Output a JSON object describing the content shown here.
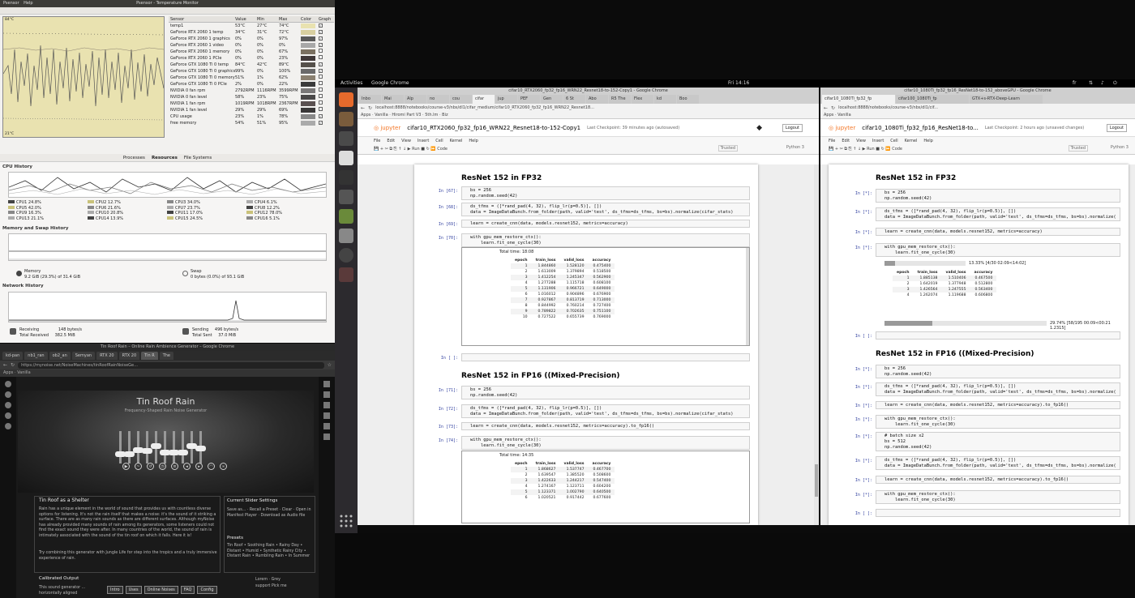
{
  "temp_monitor": {
    "title": "Psensor - Temperature Monitor",
    "menu": [
      "Psensor",
      "Help"
    ],
    "graph_top_label": "84°C",
    "graph_bottom_label": "21°C",
    "columns": [
      "Sensor",
      "Value",
      "Min",
      "Max",
      "Color",
      "Graph"
    ],
    "rows": [
      {
        "sensor": "temp1",
        "value": "53°C",
        "min": "27°C",
        "max": "74°C",
        "color": "#e9e2b0",
        "graph": "✓"
      },
      {
        "sensor": "GeForce RTX 2060 1 temp",
        "value": "34°C",
        "min": "31°C",
        "max": "72°C",
        "color": "#d8cfa0",
        "graph": "✓"
      },
      {
        "sensor": "GeForce RTX 2060 1 graphics",
        "value": "0%",
        "min": "0%",
        "max": "97%",
        "color": "#5a5a5a",
        "graph": "✓"
      },
      {
        "sensor": "GeForce RTX 2060 1 video",
        "value": "0%",
        "min": "0%",
        "max": "0%",
        "color": "#a8a8a8",
        "graph": "✓"
      },
      {
        "sensor": "GeForce RTX 2060 1 memory",
        "value": "0%",
        "min": "0%",
        "max": "67%",
        "color": "#7a7060",
        "graph": ""
      },
      {
        "sensor": "GeForce RTX 2060 1 PCIe",
        "value": "0%",
        "min": "0%",
        "max": "23%",
        "color": "#403838",
        "graph": ""
      },
      {
        "sensor": "GeForce GTX 1080 Ti 0 temp",
        "value": "84°C",
        "min": "42°C",
        "max": "89°C",
        "color": "#55504a",
        "graph": "✓"
      },
      {
        "sensor": "GeForce GTX 1080 Ti 0 graphics",
        "value": "99%",
        "min": "0%",
        "max": "100%",
        "color": "#6a6a6a",
        "graph": "✓"
      },
      {
        "sensor": "GeForce GTX 1080 Ti 0 memory",
        "value": "51%",
        "min": "1%",
        "max": "62%",
        "color": "#8a8070",
        "graph": ""
      },
      {
        "sensor": "GeForce GTX 1080 Ti 0 PCIe",
        "value": "2%",
        "min": "0%",
        "max": "22%",
        "color": "#3a3a3a",
        "graph": ""
      },
      {
        "sensor": "NVIDIA 0 fan rpm",
        "value": "2792RPM",
        "min": "1116RPM",
        "max": "3599RPM",
        "color": "#7a7878",
        "graph": ""
      },
      {
        "sensor": "NVIDIA 0 fan level",
        "value": "58%",
        "min": "23%",
        "max": "75%",
        "color": "#4a4848",
        "graph": ""
      },
      {
        "sensor": "NVIDIA 1 fan rpm",
        "value": "1019RPM",
        "min": "1018RPM",
        "max": "2367RPM",
        "color": "#5a5050",
        "graph": ""
      },
      {
        "sensor": "NVIDIA 1 fan level",
        "value": "29%",
        "min": "29%",
        "max": "69%",
        "color": "#3a3838",
        "graph": ""
      },
      {
        "sensor": "CPU usage",
        "value": "23%",
        "min": "1%",
        "max": "78%",
        "color": "#888",
        "graph": "✓"
      },
      {
        "sensor": "free memory",
        "value": "54%",
        "min": "51%",
        "max": "95%",
        "color": "#aaa",
        "graph": "✓"
      }
    ]
  },
  "sys_monitor": {
    "tabs": [
      "Processes",
      "Resources",
      "File Systems"
    ],
    "cpu_history": "CPU History",
    "cpu_legend": [
      [
        "CPU1 24.8%",
        "CPU5 42.0%",
        "CPU9 16.3%",
        "CPU13 21.1%"
      ],
      [
        "CPU2 12.7%",
        "CPU6 21.6%",
        "CPU10 20.8%",
        "CPU14 13.9%"
      ],
      [
        "CPU3 34.0%",
        "CPU7 23.7%",
        "CPU11 17.0%",
        "CPU15 24.5%"
      ],
      [
        "CPU4 6.1%",
        "CPU8 12.2%",
        "CPU12 78.0%",
        "CPU16 5.1%"
      ]
    ],
    "mem_title": "Memory and Swap History",
    "memory_label": "Memory",
    "memory_value": "9.2 GiB (29.3%) of 31.4 GiB",
    "swap_label": "Swap",
    "swap_value": "0 bytes (0.0%) of 93.1 GiB",
    "net_title": "Network History",
    "receiving_label": "Receiving",
    "receiving_value": "148 bytes/s",
    "total_received_label": "Total Received",
    "total_received_value": "382.5 MiB",
    "sending_label": "Sending",
    "sending_value": "496 bytes/s",
    "total_sent_label": "Total Sent",
    "total_sent_value": "37.0 MiB"
  },
  "mynoise": {
    "title": "Tin Roof Rain – Online Rain Ambience Generator – Google Chrome",
    "tabs": [
      "kd-pan",
      "nb1_ran",
      "ob2_an",
      "Semyan",
      "RTX 20",
      "RTX 20",
      "Tin R",
      "The"
    ],
    "url": "https://mynoise.net/NoiseMachines/tinRoofRainNoiseGe...",
    "bookmarks": "Apps  ·  Vanilla",
    "hero_title": "Tin Roof Rain",
    "hero_subtitle": "Frequency-Shaped Rain Noise Generator",
    "slider_levels": [
      0.25,
      0.25,
      0.4,
      0.35,
      0.55,
      0.3,
      0.3,
      0.3,
      0.55,
      0.45
    ],
    "section_title": "Tin Roof as a Shelter",
    "section_text": "Rain has a unique element in the world of sound that provides us with countless diverse options for listening. It's not the rain itself that makes a noise: it's the sound of it striking a surface. There are as many rain sounds as there are different surfaces. Although myNoise has already provided many sounds of rain among its generators, some listeners could not find the exact sound they were after. In many countries of the world, the sound of rain is intimately associated with the sound of the tin roof on which it falls. Here it is!",
    "section_text2": "Try combining this generator with Jungle Life for step into the tropics and a truly immersive experience of rain.",
    "settings_title": "Current Slider Settings",
    "settings_items": "Save as... · Recall a Preset · Clear · Open in Manifest Player · Download as Audio file",
    "presets_title": "Presets",
    "presets_text": "Tin Roof • Soothing Rain • Rainy Day • Distant • Humid • Synthetic Rainy City • Distant Rain • Rumbling Rain • In Summer",
    "calib_title": "Calibrated Output",
    "calib_text": "This sound generator ... horizontally aligned",
    "bottom_buttons": [
      "Intro",
      "Uses",
      "Online Noises",
      "FAQ",
      "Config"
    ],
    "lines_text": "Lorem · Grey",
    "support_text": "support Pick me"
  },
  "ubuntu": {
    "activities": "Activities",
    "app": "Google Chrome",
    "clock": "Fri 14:16",
    "lang": "fr"
  },
  "jupyter_left": {
    "window_title": "cifar10_RTX2060_fp32_fp16_WRN22_Resnet18-to-152-Copy1 - Google Chrome",
    "tabs": [
      "Inbo",
      "Mai",
      "Alp",
      "no",
      "cou",
      "cifar",
      "jup",
      "PEF",
      "Gen",
      "6 St",
      "Abo",
      "R5 The",
      "Flex",
      "kd",
      "Boo"
    ],
    "url": "localhost:8888/notebooks/course-v3/nbs/dl1/cifar_medium/cifar10_RTX2060_fp32_fp16_WRN22_Resnet18...",
    "bookmarks": "Apps · Vanilla · Hiromi Part V3 · 5th.lm · Biz",
    "nb_title": "cifar10_RTX2060_fp32_fp16_WRN22_Resnet18-to-152-Copy1",
    "checkpoint": "Last Checkpoint: 39 minutes ago  (autosaved)",
    "menu": [
      "File",
      "Edit",
      "View",
      "Insert",
      "Cell",
      "Kernel",
      "Help"
    ],
    "trusted": "Trusted",
    "kernel": "Python 3",
    "logout": "Logout",
    "h_fp32": "ResNet 152 in FP32",
    "p67": "In [67]:",
    "c67": "bs = 256\nnp.random.seed(42)",
    "p68": "In [68]:",
    "c68": "ds_tfms = ([*rand_pad(4, 32), flip_lr(p=0.5)], [])\ndata = ImageDataBunch.from_folder(path, valid='test', ds_tfms=ds_tfms, bs=bs).normalize(cifar_stats)",
    "p69": "In [69]:",
    "c69": "learn = create_cnn(data, models.resnet152, metrics=accuracy)",
    "p70": "In [70]:",
    "c70": "with gpu_mem_restore_ctx():\n    learn.fit_one_cycle(30)",
    "total_time_1": "Total time: 18:08",
    "table_cols": [
      "epoch",
      "train_loss",
      "valid_loss",
      "accuracy"
    ],
    "table1": [
      [
        "1",
        "1.844860",
        "1.528120",
        "0.475400"
      ],
      [
        "2",
        "1.613009",
        "1.379894",
        "0.518500"
      ],
      [
        "3",
        "1.412254",
        "1.245347",
        "0.562900"
      ],
      [
        "4",
        "1.277288",
        "1.115718",
        "0.608100"
      ],
      [
        "5",
        "1.131906",
        "0.966721",
        "0.649000"
      ],
      [
        "6",
        "1.016012",
        "0.904896",
        "0.676900"
      ],
      [
        "7",
        "0.927867",
        "0.813719",
        "0.713000"
      ],
      [
        "8",
        "0.844992",
        "0.760214",
        "0.727400"
      ],
      [
        "9",
        "0.789822",
        "0.702635",
        "0.751100"
      ],
      [
        "10",
        "0.727522",
        "0.655739",
        "0.769000"
      ]
    ],
    "p_empty": "In [ ]:",
    "h_fp16": "ResNet 152 in FP16 ((Mixed-Precision)",
    "p71": "In [71]:",
    "c71": "bs = 256\nnp.random.seed(42)",
    "p72": "In [72]:",
    "c72": "ds_tfms = ([*rand_pad(4, 32), flip_lr(p=0.5)], [])\ndata = ImageDataBunch.from_folder(path, valid='test', ds_tfms=ds_tfms, bs=bs).normalize(cifar_stats)",
    "p73": "In [73]:",
    "c73": "learn = create_cnn(data, models.resnet152, metrics=accuracy).to_fp16()",
    "p74": "In [74]:",
    "c74": "with gpu_mem_restore_ctx():\n    learn.fit_one_cycle(30)",
    "total_time_2": "Total time: 14:35",
    "table2": [
      [
        "1",
        "1.868627",
        "1.537747",
        "0.467700"
      ],
      [
        "2",
        "1.639547",
        "1.385520",
        "0.508600"
      ],
      [
        "3",
        "1.422633",
        "1.244217",
        "0.547400"
      ],
      [
        "4",
        "1.274167",
        "1.123711",
        "0.604200"
      ],
      [
        "5",
        "1.123371",
        "1.002790",
        "0.640500"
      ],
      [
        "6",
        "1.020521",
        "0.917442",
        "0.677600"
      ]
    ]
  },
  "jupyter_right": {
    "window_title": "cifar10_1080Ti_fp32_fp16_ResNet18-to-152_aboveGPU - Google Chrome",
    "tabs": [
      "cifar10_1080Ti_fp32_fp",
      "cifar100_1080Ti_fp",
      "GTX+s-RTX-Deep-Learn"
    ],
    "url": "localhost:8888/notebooks/course-v3/nbs/dl1/cif...",
    "bookmarks": "Apps · Vanilla",
    "nb_title": "cifar10_1080Ti_fp32_fp16_ResNet18-to...",
    "checkpoint": "Last Checkpoint: 2 hours ago  (unsaved changes)",
    "menu": [
      "File",
      "Edit",
      "View",
      "Insert",
      "Cell",
      "Kernel",
      "Help"
    ],
    "trusted": "Trusted",
    "kernel": "Python 3",
    "logout": "Logout",
    "h_fp32": "ResNet 152 in FP32",
    "p_star": "In [*]:",
    "c1": "bs = 256\nnp.random.seed(42)",
    "c2": "ds_tfms = ([*rand_pad(4, 32), flip_lr(p=0.5)], [])\ndata = ImageDataBunch.from_folder(path, valid='test', ds_tfms=ds_tfms, bs=bs).normalize(",
    "c3": "learn = create_cnn(data, models.resnet152, metrics=accuracy)",
    "c4": "with gpu_mem_restore_ctx():\n    learn.fit_one_cycle(30)",
    "progress1": "13.33% [4/30 02:09<14:02]",
    "progress1_value": 0.1333,
    "table_cols": [
      "epoch",
      "train_loss",
      "valid_loss",
      "accuracy"
    ],
    "table": [
      [
        "1",
        "1.885138",
        "1.510406",
        "0.467500"
      ],
      [
        "2",
        "1.642019",
        "1.377948",
        "0.512800"
      ],
      [
        "3",
        "1.426564",
        "1.247555",
        "0.563400"
      ],
      [
        "4",
        "1.262074",
        "1.119688",
        "0.606800"
      ]
    ],
    "progress2": "29.74% [58/195 00:09<00:21 1.2315]",
    "progress2_value": 0.2974,
    "p_empty": "In [ ]:",
    "h_fp16": "ResNet 152 in FP16 ((Mixed-Precision)",
    "c5": "bs = 256\nnp.random.seed(42)",
    "c6": "ds_tfms = ([*rand_pad(4, 32), flip_lr(p=0.5)], [])\ndata = ImageDataBunch.from_folder(path, valid='test', ds_tfms=ds_tfms, bs=bs).normalize(",
    "c7": "learn = create_cnn(data, models.resnet152, metrics=accuracy).to_fp16()",
    "c8": "with gpu_mem_restore_ctx():\n    learn.fit_one_cycle(30)",
    "c9": "# batch size x2\nbs = 512\nnp.random.seed(42)",
    "c10": "ds_tfms = ([*rand_pad(4, 32), flip_lr(p=0.5)], [])\ndata = ImageDataBunch.from_folder(path, valid='test', ds_tfms=ds_tfms, bs=bs).normalize(",
    "c11": "learn = create_cnn(data, models.resnet152, metrics=accuracy).to_fp16()",
    "c12": "with gpu_mem_restore_ctx():\n    learn.fit_one_cycle(30)"
  }
}
